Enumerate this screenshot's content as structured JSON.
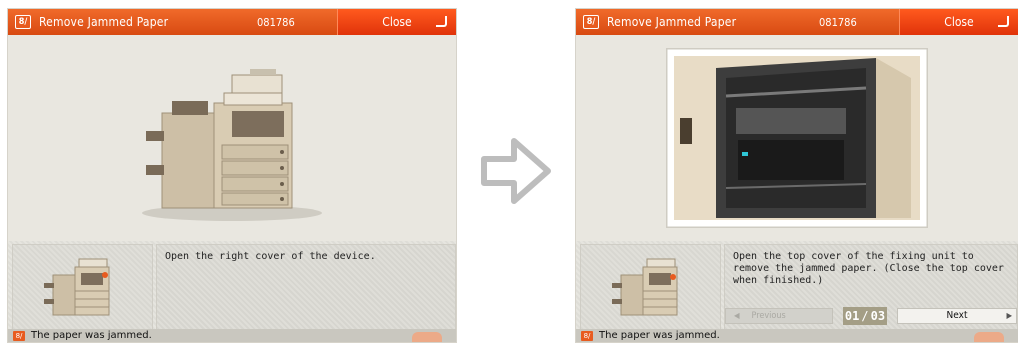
{
  "left_screen": {
    "title": "Remove Jammed Paper",
    "title_icon": "8/",
    "job_code": "081786",
    "close_label": "Close",
    "instruction": "Open the right cover of the device.",
    "status": "The paper was jammed."
  },
  "right_screen": {
    "title": "Remove Jammed Paper",
    "title_icon": "8/",
    "job_code": "081786",
    "close_label": "Close",
    "instruction": "Open the top cover of the fixing unit to remove the jammed paper. (Close the top cover when finished.)",
    "previous_label": "Previous",
    "page_current": "01",
    "page_separator": "/",
    "page_total": "03",
    "next_label": "Next",
    "status": "The paper was jammed."
  },
  "icons": {
    "title": "jam-icon",
    "status": "jam-icon",
    "transition": "right-arrow-icon",
    "close": "enter-icon",
    "previous": "left-triangle-icon",
    "next": "right-triangle-icon"
  },
  "colors": {
    "title_bar": "#e85b1f",
    "close_button": "#ee4415",
    "panel_bg": "#e9e7e0",
    "page_indicator": "#a49e86"
  }
}
